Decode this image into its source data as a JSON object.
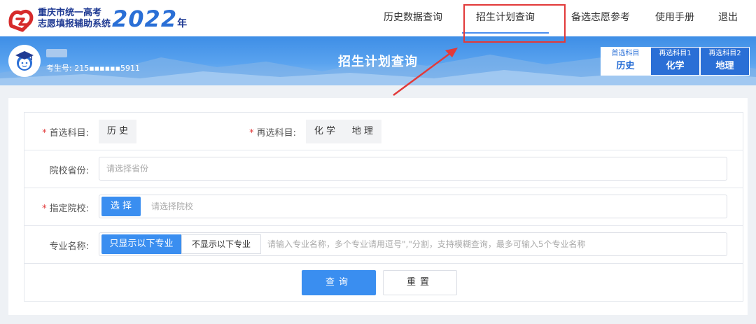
{
  "brand": {
    "line1": "重庆市统一高考",
    "line2": "志愿填报辅助系统",
    "year": "2022",
    "year_suffix": "年",
    "accent_color": "#2a6fd6"
  },
  "nav": {
    "items": [
      {
        "label": "历史数据查询",
        "active": false
      },
      {
        "label": "招生计划查询",
        "active": true
      },
      {
        "label": "备选志愿参考",
        "active": false
      },
      {
        "label": "使用手册",
        "active": false
      },
      {
        "label": "退出",
        "active": false
      }
    ]
  },
  "student": {
    "id_label": "考生号:",
    "id_value": "215▪▪▪▪▪▪5911"
  },
  "banner": {
    "title": "招生计划查询"
  },
  "subjects": [
    {
      "label": "首选科目",
      "value": "历史"
    },
    {
      "label": "再选科目1",
      "value": "化学"
    },
    {
      "label": "再选科目2",
      "value": "地理"
    }
  ],
  "form": {
    "first_subject": {
      "label": "首选科目:",
      "value": "历 史"
    },
    "second_subject": {
      "label": "再选科目:",
      "values": [
        "化 学",
        "地 理"
      ]
    },
    "province": {
      "label": "院校省份:",
      "placeholder": "请选择省份"
    },
    "school": {
      "label": "指定院校:",
      "select_label": "选 择",
      "placeholder": "请选择院校"
    },
    "major": {
      "label": "专业名称:",
      "option_show": "只显示以下专业",
      "option_hide": "不显示以下专业",
      "placeholder": "请输入专业名称，多个专业请用逗号\",\"分割，支持模糊查询，最多可输入5个专业名称"
    },
    "query_label": "查询",
    "reset_label": "重置"
  },
  "colors": {
    "primary": "#3a8ef0",
    "highlight": "#e23a3a"
  }
}
